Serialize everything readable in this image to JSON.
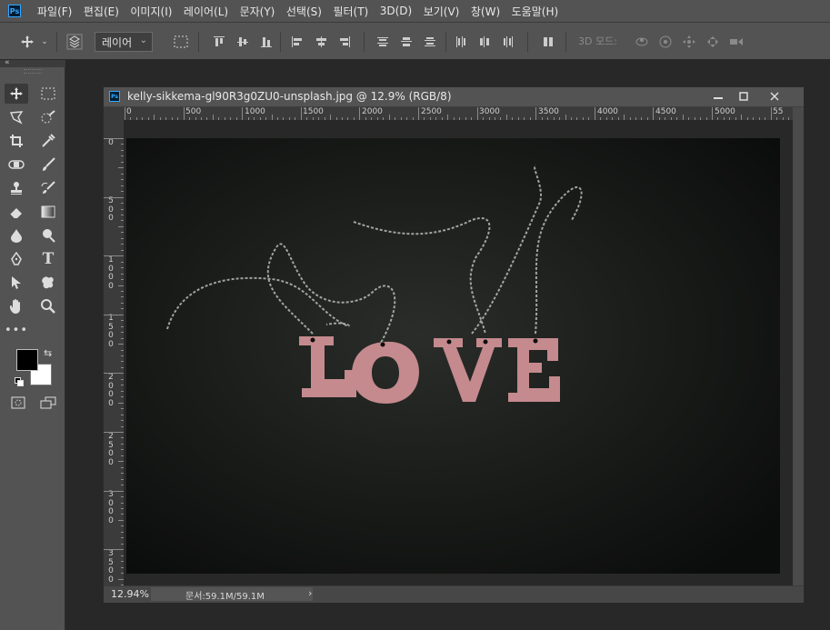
{
  "app": {
    "logo": "Ps"
  },
  "menu": [
    "파일(F)",
    "편집(E)",
    "이미지(I)",
    "레이어(L)",
    "문자(Y)",
    "선택(S)",
    "필터(T)",
    "3D(D)",
    "보기(V)",
    "창(W)",
    "도움말(H)"
  ],
  "options": {
    "auto_select_target": "레이어",
    "mode_3d_label": "3D 모드:"
  },
  "document": {
    "title": "kelly-sikkema-gl90R3g0ZU0-unsplash.jpg @ 12.9% (RGB/8)",
    "zoom": "12.94%",
    "doc_size": "문서:59.1M/59.1M",
    "status_arrow": "›",
    "minimize": "—",
    "close": "✕"
  },
  "ruler_h": [
    "0",
    "500",
    "1000",
    "1500",
    "2000",
    "2500",
    "3000",
    "3500",
    "4000",
    "4500",
    "5000",
    "55"
  ],
  "ruler_v": [
    [
      "0"
    ],
    [
      "5",
      "0",
      "0"
    ],
    [
      "1",
      "0",
      "0",
      "0"
    ],
    [
      "1",
      "5",
      "0",
      "0"
    ],
    [
      "2",
      "0",
      "0",
      "0"
    ],
    [
      "2",
      "5",
      "0",
      "0"
    ],
    [
      "3",
      "0",
      "0",
      "0"
    ],
    [
      "3",
      "5",
      "0",
      "0"
    ]
  ],
  "image": {
    "word": "LOVE",
    "letter_color": "#c48a8e",
    "background_color": "#151715"
  }
}
